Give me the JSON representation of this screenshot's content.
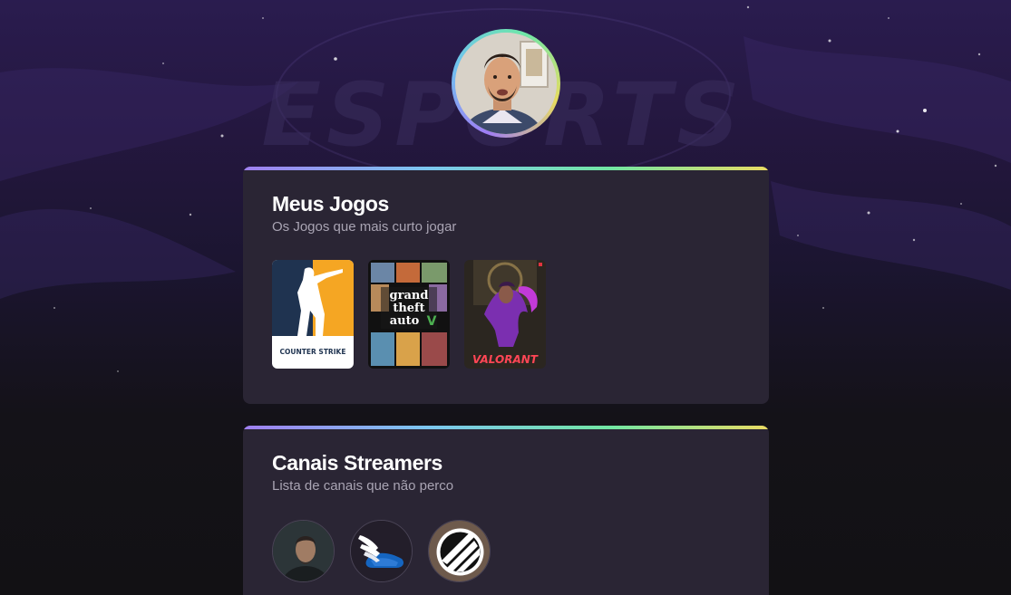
{
  "profile": {
    "avatar_icon": "profile-photo"
  },
  "games_section": {
    "title": "Meus Jogos",
    "subtitle": "Os Jogos que mais curto jogar",
    "games": [
      {
        "name": "Counter-Strike",
        "logo_text": "COUNTER STRIKE",
        "icon": "counter-strike-cover"
      },
      {
        "name": "Grand Theft Auto V",
        "logo_line1": "grand",
        "logo_line2": "theft",
        "logo_line3": "auto",
        "icon": "gta-v-cover"
      },
      {
        "name": "Valorant",
        "logo_text": "VALORANT",
        "icon": "valorant-cover"
      }
    ]
  },
  "streamers_section": {
    "title": "Canais Streamers",
    "subtitle": "Lista de canais que não perco",
    "streamers": [
      {
        "icon": "streamer-photo-avatar"
      },
      {
        "icon": "winged-shoe-logo"
      },
      {
        "icon": "esl-logo"
      }
    ]
  },
  "colors": {
    "accent_gradient": [
      "#a07ff0",
      "#7cc6f0",
      "#72e6a3",
      "#eadb63"
    ],
    "card_bg": "#2a2534",
    "title": "#ffffff",
    "subtitle": "#a9a4b3"
  },
  "background": {
    "watermark_text": "ESPORTS"
  }
}
